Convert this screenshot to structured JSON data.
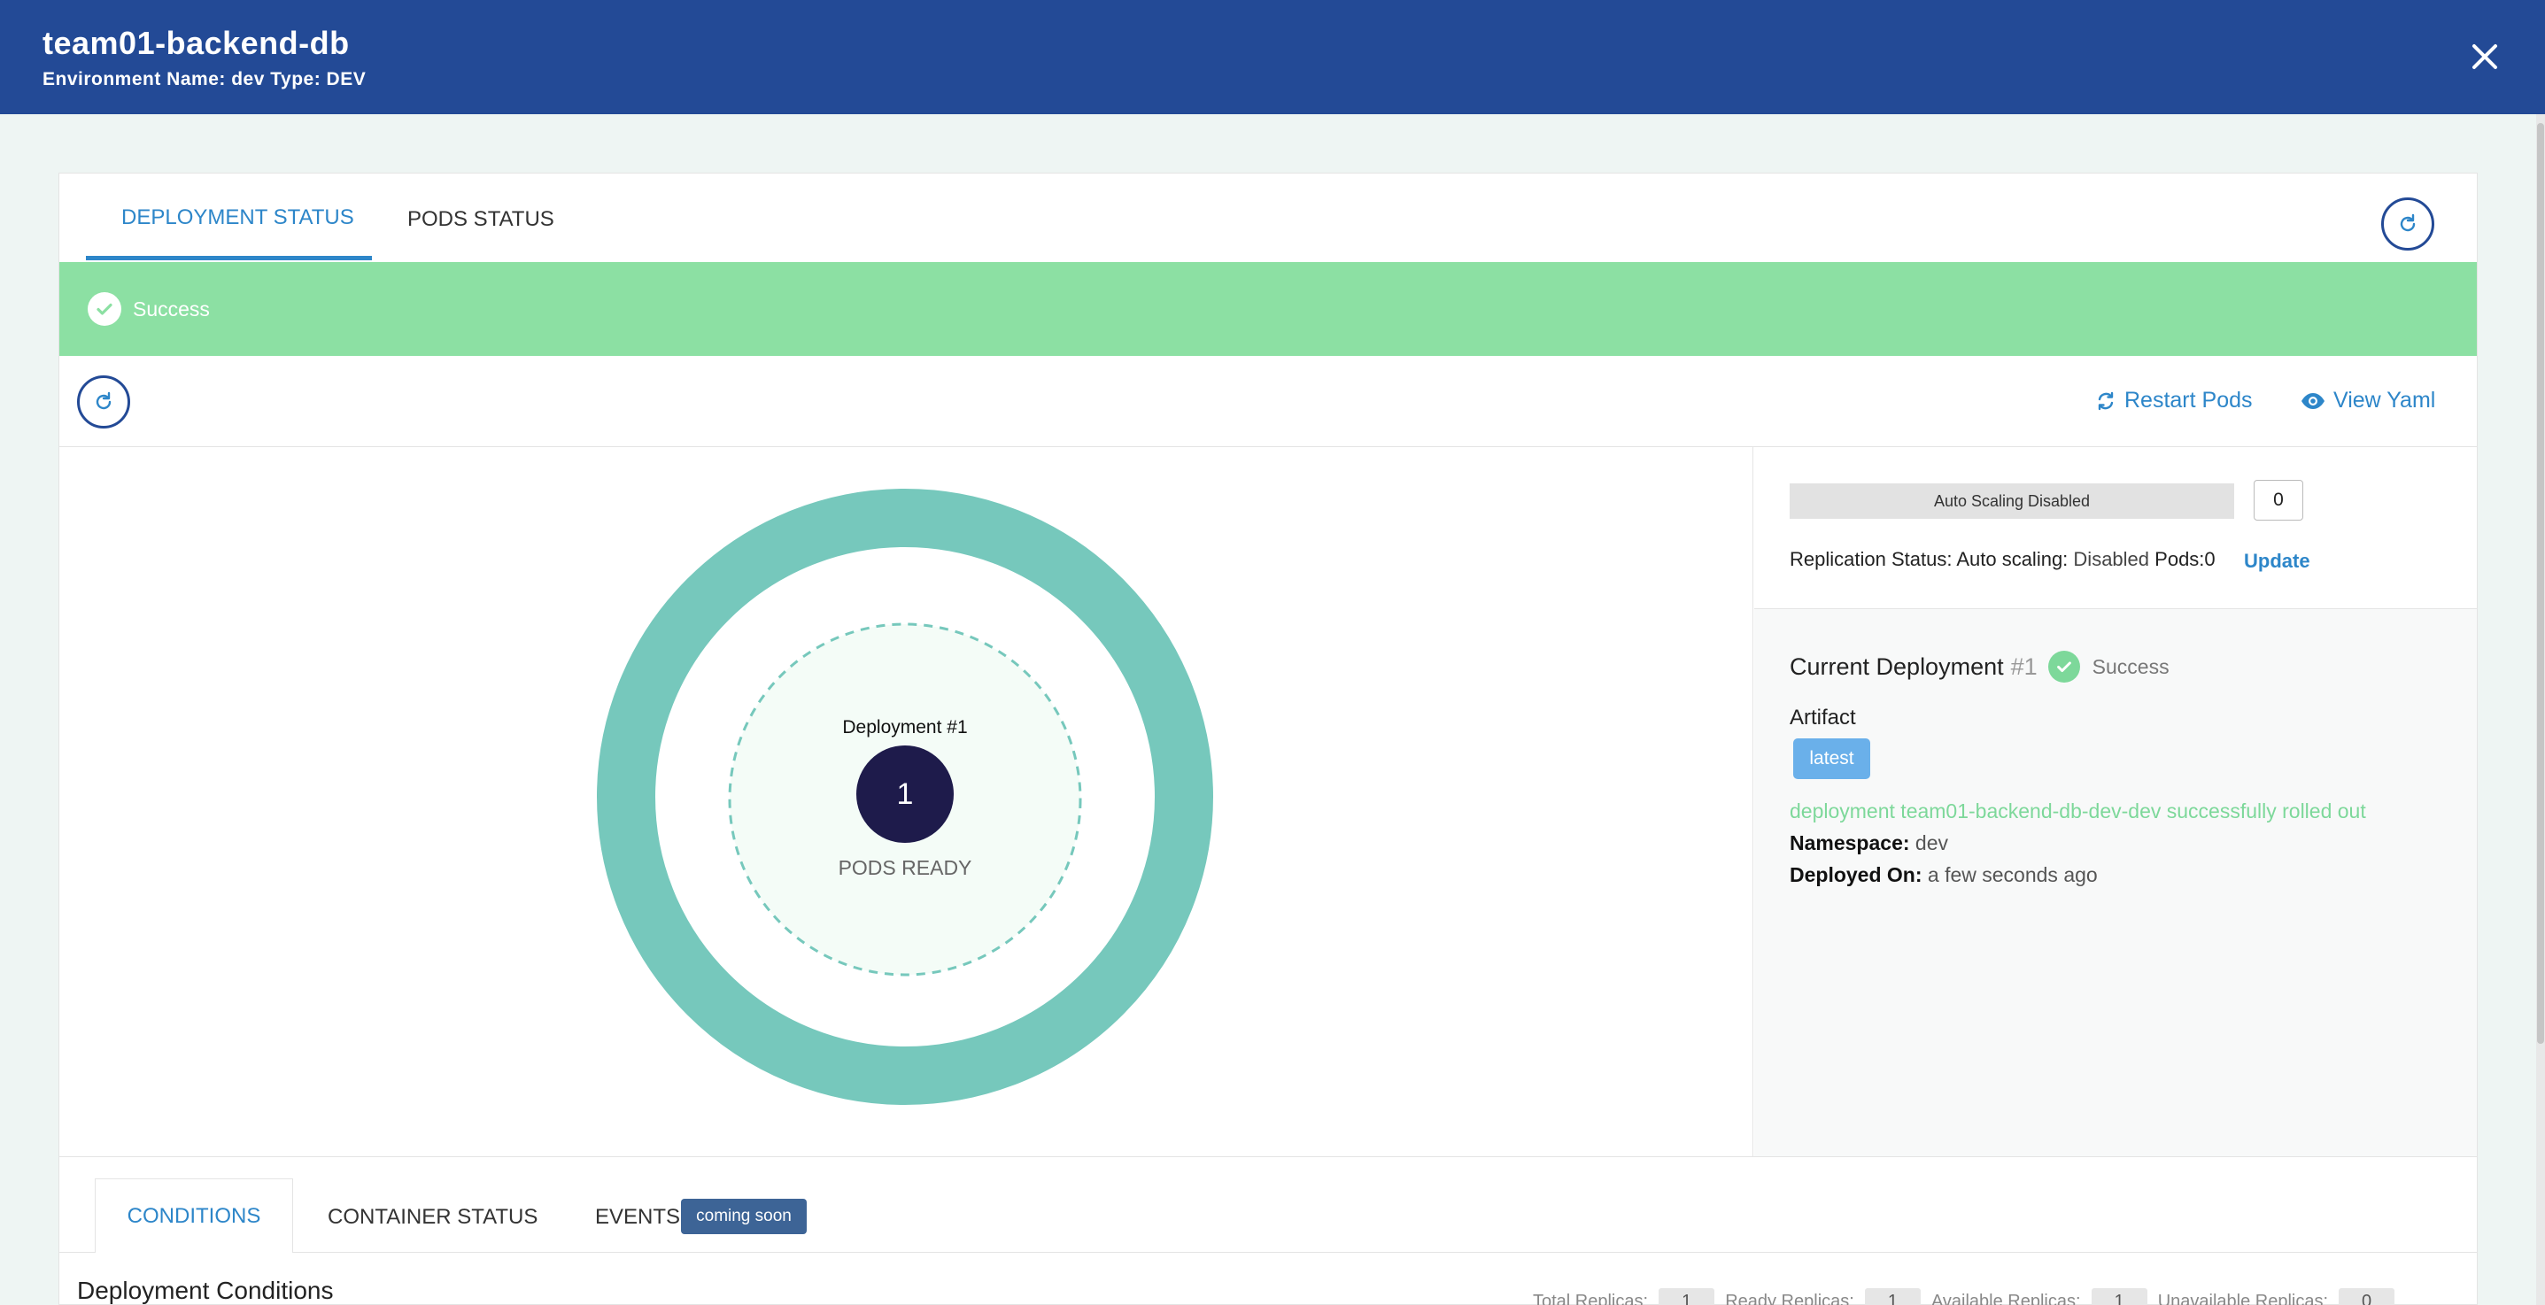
{
  "header": {
    "title": "team01-backend-db",
    "env_label": "Environment Name:",
    "env_value": "dev",
    "type_label": "Type:",
    "type_value": "DEV",
    "close_icon": "close-icon"
  },
  "tabs": {
    "deployment_status": "DEPLOYMENT STATUS",
    "pods_status": "PODS STATUS"
  },
  "banner": {
    "status": "Success",
    "icon": "check-circle-icon"
  },
  "toolbar": {
    "restart_pods": "Restart Pods",
    "view_yaml": "View Yaml"
  },
  "deployment_graphic": {
    "label": "Deployment #1",
    "ready_count": "1",
    "ready_label": "PODS READY",
    "ring_color": "#76c8bc",
    "pod_color": "#1e1b4b"
  },
  "scaling": {
    "autoscale_label": "Auto Scaling Disabled",
    "replica_count": "0",
    "replication_prefix": "Replication Status: Auto scaling:",
    "replication_disabled": "Disabled",
    "pods_label": "Pods:0",
    "update_label": "Update"
  },
  "current_deployment": {
    "title": "Current Deployment",
    "number": "#1",
    "status": "Success",
    "artifact_label": "Artifact",
    "artifact_tag": "latest",
    "rollout_message": "deployment team01-backend-db-dev-dev successfully rolled out",
    "namespace_label": "Namespace:",
    "namespace_value": "dev",
    "deployed_on_label": "Deployed On:",
    "deployed_on_value": "a few seconds ago"
  },
  "bottom_tabs": {
    "conditions": "CONDITIONS",
    "container_status": "CONTAINER STATUS",
    "events": "EVENTS",
    "coming_soon": "coming soon"
  },
  "conditions": {
    "title": "Deployment Conditions",
    "total_label": "Total Replicas:",
    "total_value": "1",
    "ready_label": "Ready Replicas:",
    "ready_value": "1",
    "available_label": "Available Replicas:",
    "available_value": "1",
    "unavailable_label": "Unavailable Replicas:",
    "unavailable_value": "0"
  }
}
